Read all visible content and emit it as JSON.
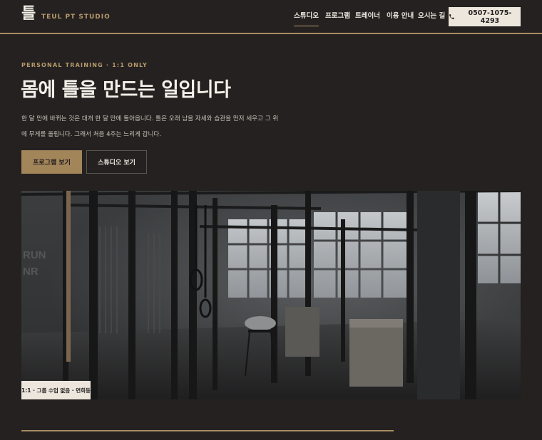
{
  "brand": {
    "mark": "틀",
    "name": "TEUL PT STUDIO"
  },
  "nav": {
    "items": [
      {
        "label": "스튜디오",
        "active": true
      },
      {
        "label": "프로그램",
        "active": false
      },
      {
        "label": "트레이너",
        "active": false
      },
      {
        "label": "이용 안내",
        "active": false
      },
      {
        "label": "오시는 길",
        "active": false
      }
    ],
    "phone": "0507-1075-4293",
    "phone_icon": "phone-icon"
  },
  "hero": {
    "eyebrow": "PERSONAL TRAINING · 1:1 ONLY",
    "headline": "몸에 틀을 만드는 일입니다",
    "intro_line1": "한 달 만에 바뀌는 것은 대개 한 달 만에 돌아옵니다. 틀은 오래 남을 자세와 습관을 먼저 세우고 그 위",
    "intro_line2": "에 무게를 올립니다. 그래서 처음 4주는 느리게 갑니다.",
    "primary_cta": "프로그램 보기",
    "secondary_cta": "스튜디오 보기"
  },
  "photo": {
    "caption": "1:1 · 그룹 수업 없음 · 연희동",
    "wall_text_1": "RUN",
    "wall_text_2": "NR"
  },
  "colors": {
    "background": "#242120",
    "accent": "#a88c62",
    "primary_button": "#a3855a",
    "light_button": "#ece6dc"
  }
}
